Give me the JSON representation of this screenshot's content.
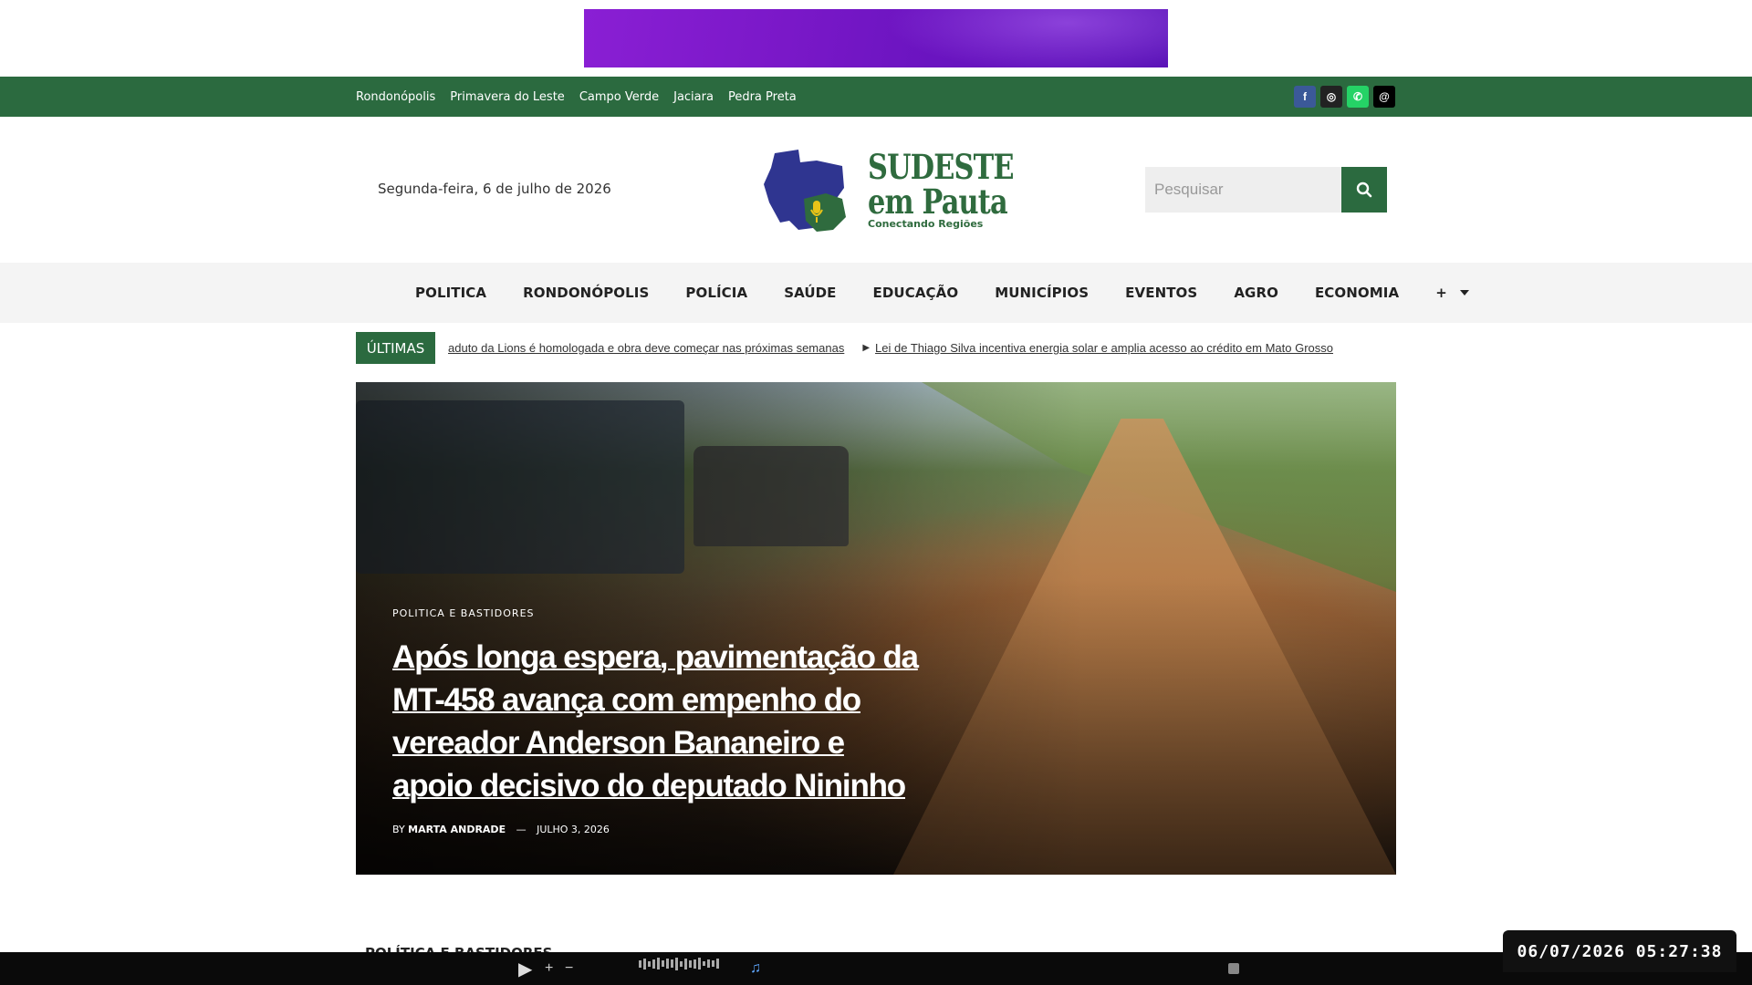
{
  "ad": {
    "name": "advertisement-banner"
  },
  "topbar": {
    "cities": [
      "Rondonópolis",
      "Primavera do Leste",
      "Campo Verde",
      "Jaciara",
      "Pedra Preta"
    ],
    "socials": [
      {
        "name": "facebook",
        "glyph": "f"
      },
      {
        "name": "instagram",
        "glyph": "◎"
      },
      {
        "name": "whatsapp",
        "glyph": "✆"
      },
      {
        "name": "threads",
        "glyph": "@"
      }
    ]
  },
  "header": {
    "date": "Segunda-feira, 6 de julho de 2026",
    "logo_line1": "SUDESTE",
    "logo_line2": "em Pauta",
    "logo_tagline": "Conectando Regiões",
    "search_placeholder": "Pesquisar"
  },
  "nav": {
    "items": [
      "POLITICA",
      "RONDONÓPOLIS",
      "POLÍCIA",
      "SAÚDE",
      "EDUCAÇÃO",
      "MUNICÍPIOS",
      "EVENTOS",
      "AGRO",
      "ECONOMIA"
    ],
    "more": "+"
  },
  "ticker": {
    "label": "ÚLTIMAS",
    "items": [
      "aduto da Lions é homologada e obra deve começar nas próximas semanas",
      "Lei de Thiago Silva incentiva energia solar e amplia acesso ao crédito em Mato Grosso"
    ]
  },
  "hero": {
    "category": "POLITICA E BASTIDORES",
    "title": "Após longa espera, pavimentação da MT-458 avança com empenho do vereador Anderson Bananeiro e apoio decisivo do deputado Nininho",
    "by": "BY",
    "author": "MARTA ANDRADE",
    "date": "JULHO 3, 2026"
  },
  "section": {
    "heading": "POLÍTICA E BASTIDORES"
  },
  "clock": {
    "text": "06/07/2026 05:27:38"
  },
  "player": {
    "play": "▶",
    "plus": "+",
    "minus": "−",
    "note": "♫"
  }
}
